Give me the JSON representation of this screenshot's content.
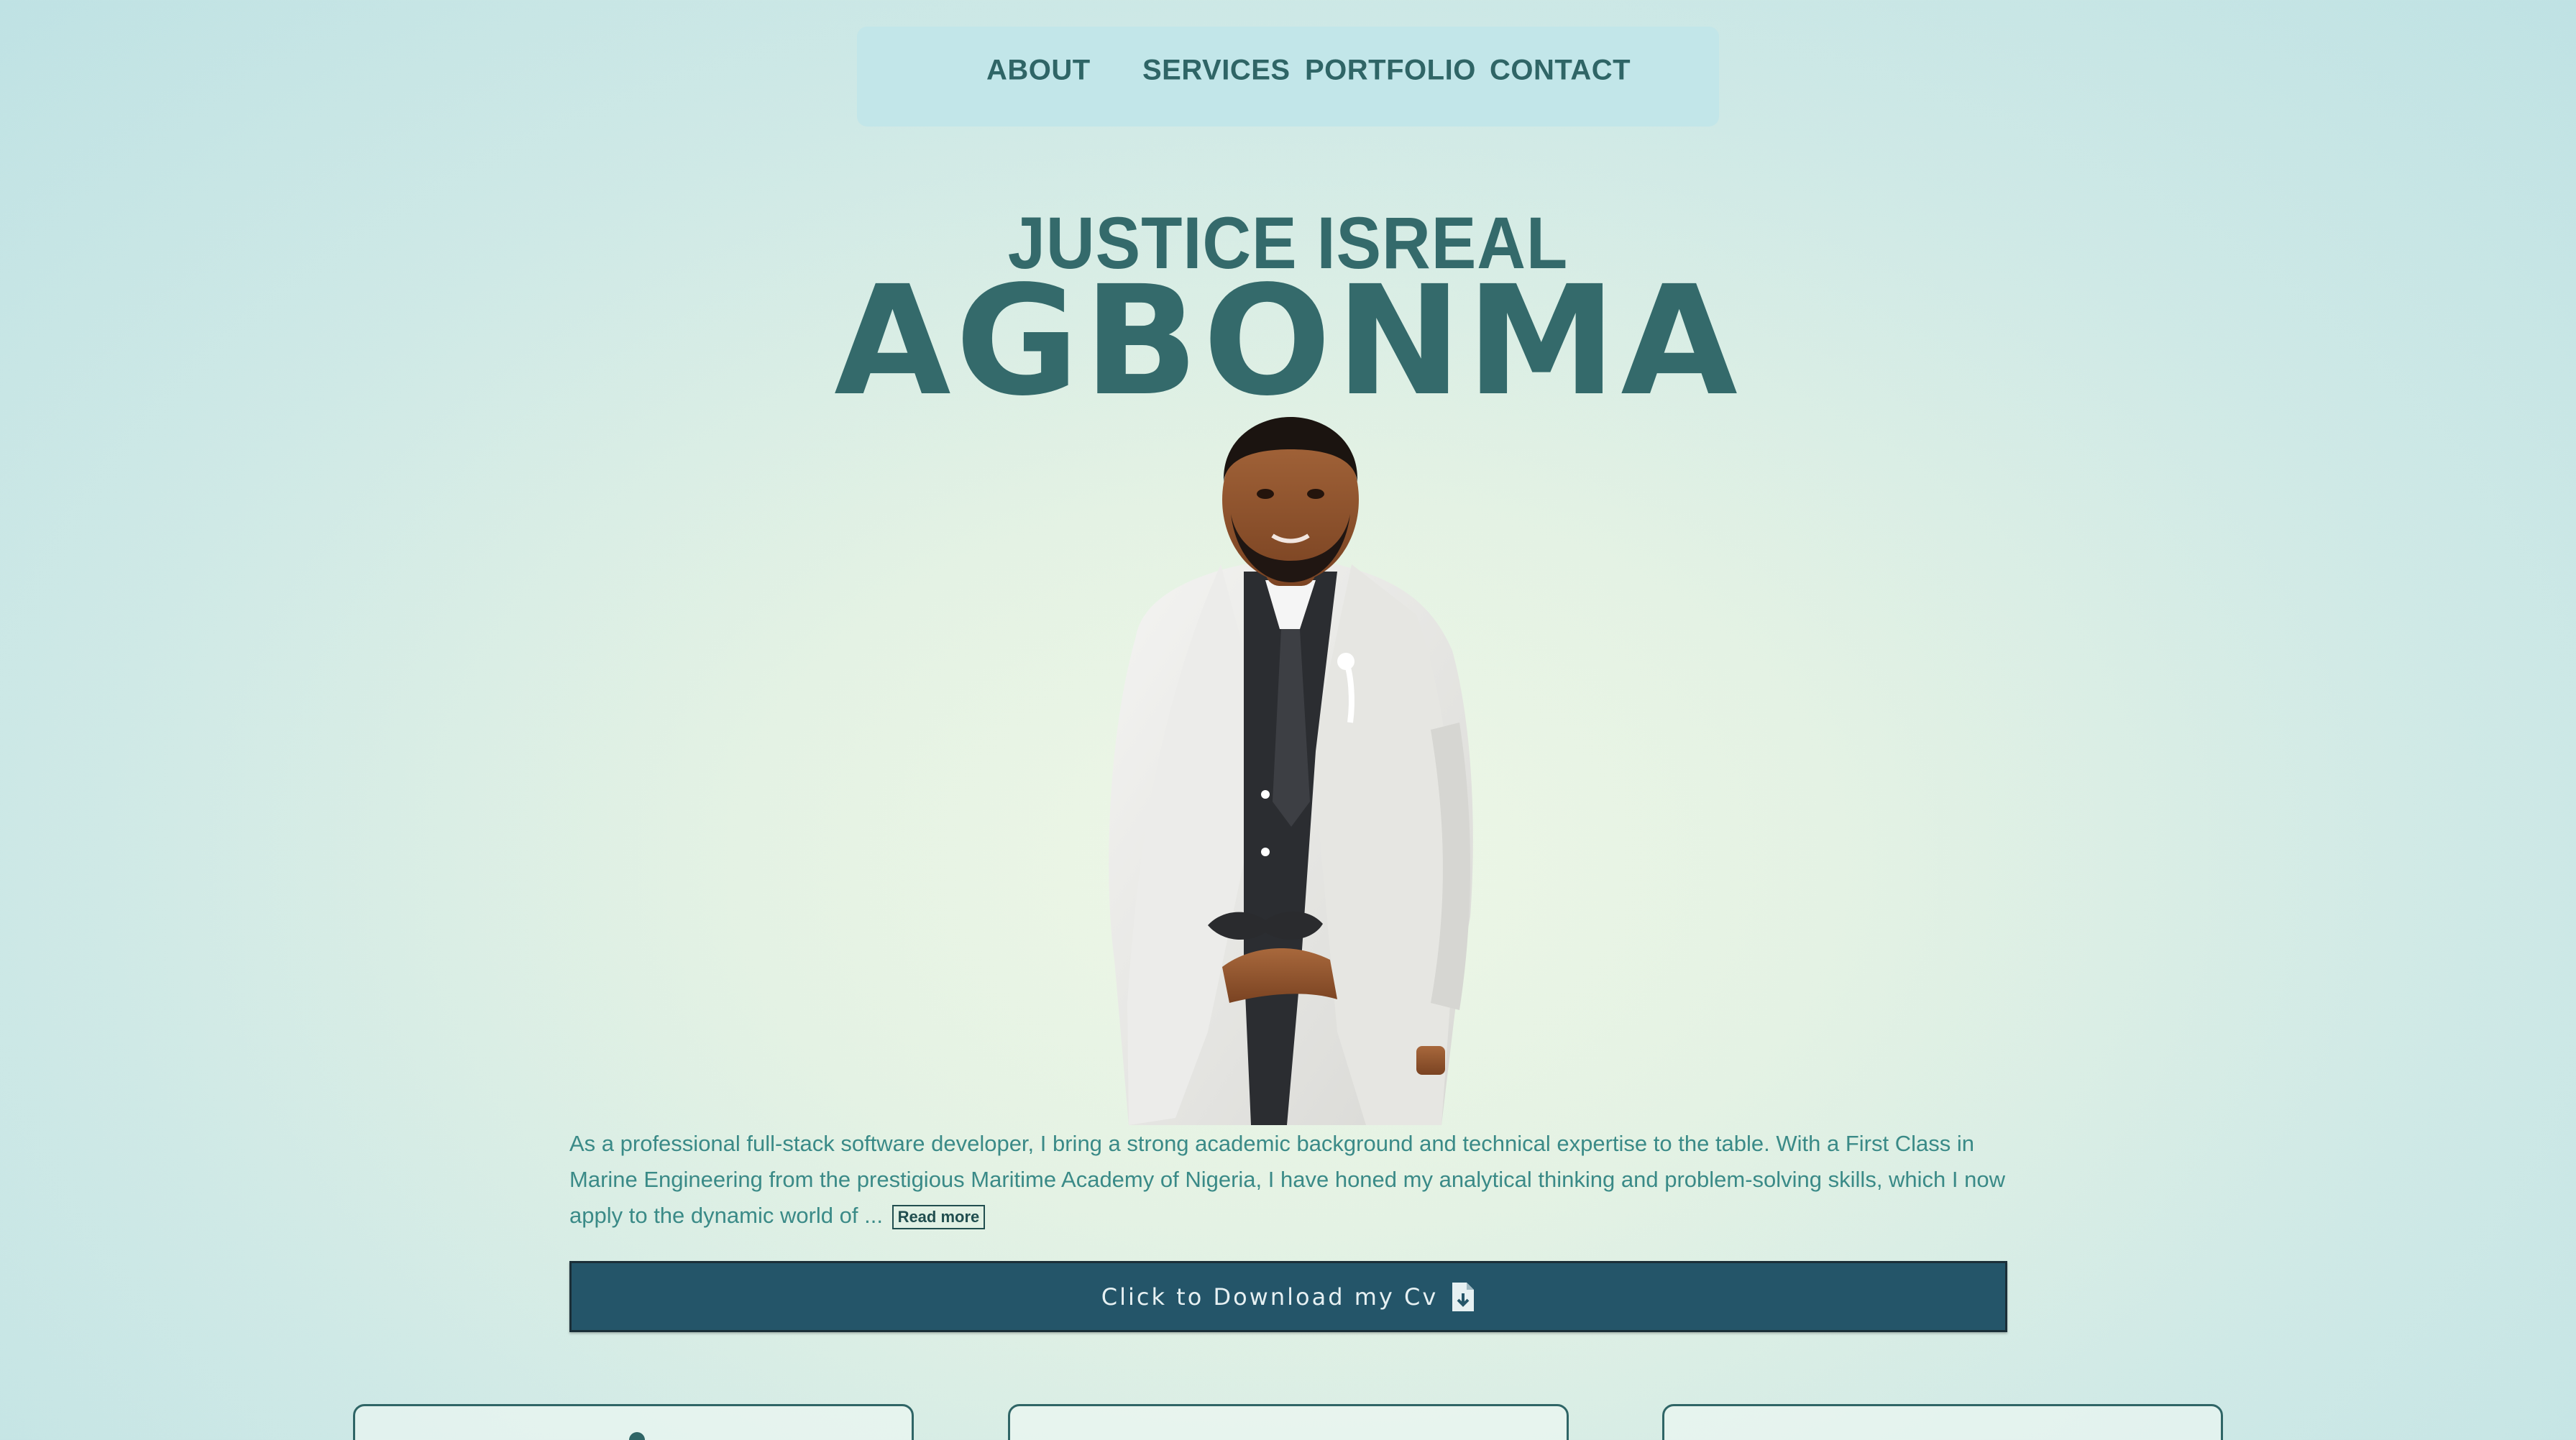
{
  "nav": {
    "items": [
      {
        "label": "ABOUT"
      },
      {
        "label": "SERVICES"
      },
      {
        "label": "PORTFOLIO"
      },
      {
        "label": "CONTACT"
      }
    ]
  },
  "hero": {
    "first_name": "JUSTICE ISREAL",
    "last_name": "AGBONMA",
    "portrait_icon": "person-portrait"
  },
  "bio": {
    "text": "As a professional full-stack software developer, I bring a strong academic background and technical expertise to the table. With a First Class in Marine Engineering from the prestigious Maritime Academy of Nigeria, I have honed my analytical thinking and problem-solving skills, which I now apply to the dynamic world of ...",
    "read_more_label": "Read more"
  },
  "cv": {
    "label": "Click to Download my Cv",
    "icon": "file-download-icon"
  },
  "colors": {
    "accent": "#346a6b",
    "button": "#245569",
    "nav_bg": "#c2e6e9",
    "bio_text": "#3a8a87"
  }
}
